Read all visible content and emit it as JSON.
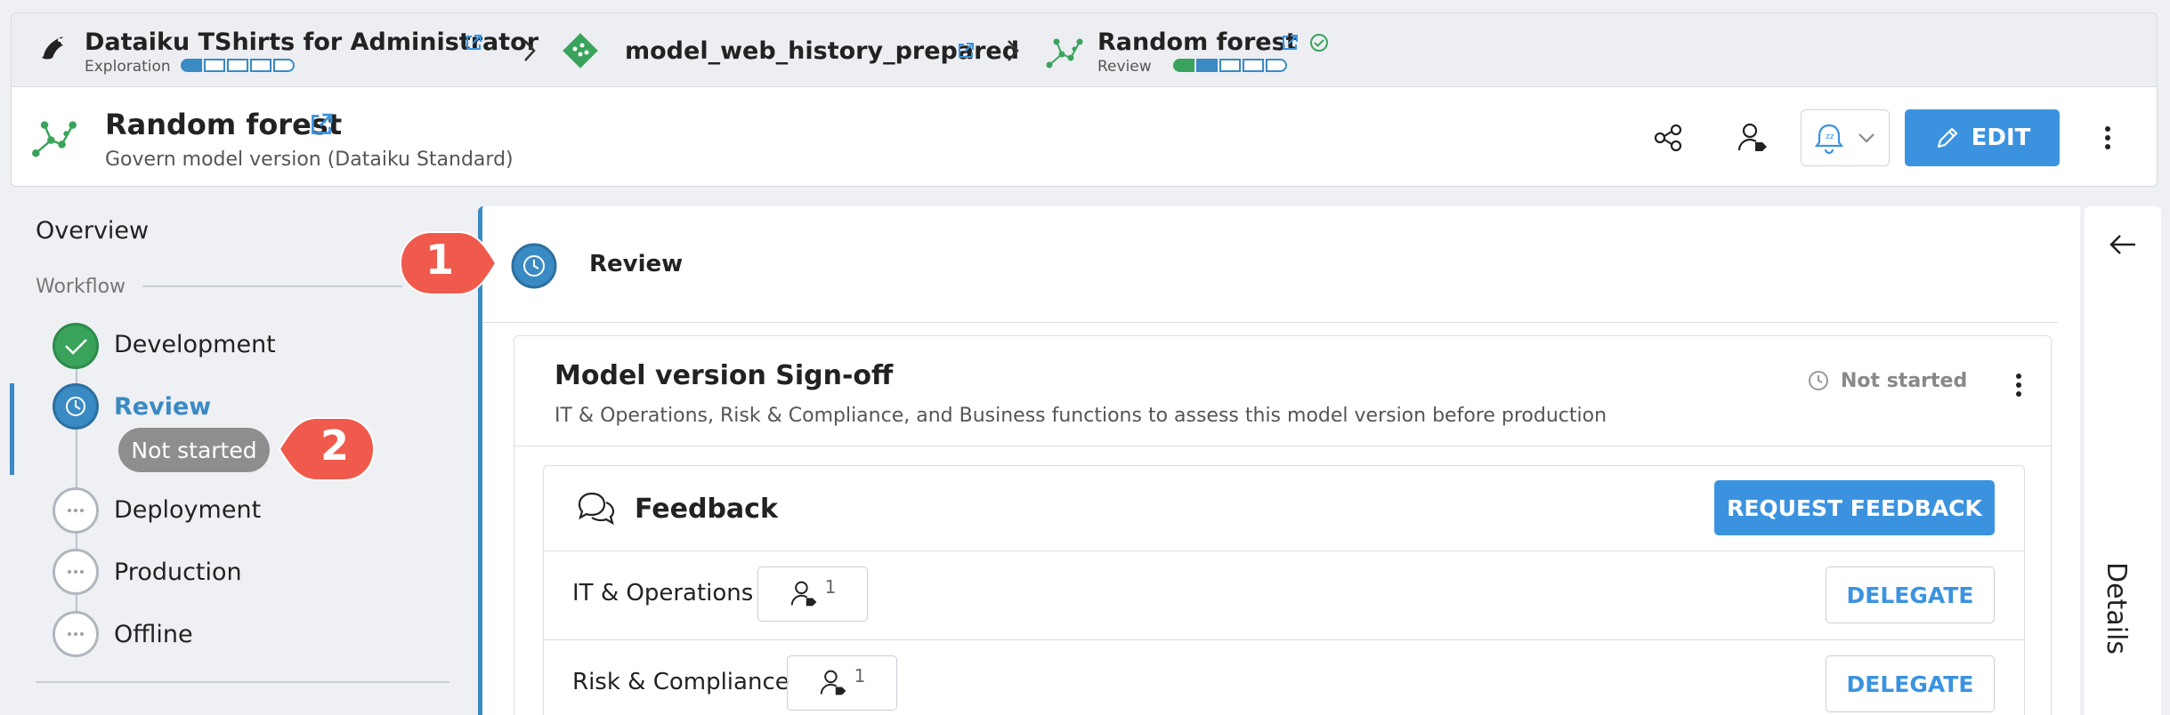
{
  "breadcrumb": {
    "project": {
      "title": "Dataiku TShirts for Administrator",
      "subtitle": "Exploration"
    },
    "model": {
      "title": "model_web_history_prepared"
    },
    "version": {
      "title": "Random forest",
      "subtitle": "Review"
    }
  },
  "header": {
    "title": "Random forest",
    "subtitle": "Govern model version (Dataiku Standard)",
    "edit_label": "EDIT"
  },
  "nav": {
    "overview": "Overview",
    "workflow_label": "Workflow",
    "stages": [
      {
        "label": "Development",
        "state": "done"
      },
      {
        "label": "Review",
        "state": "active"
      },
      {
        "label": "Deployment",
        "state": "pending"
      },
      {
        "label": "Production",
        "state": "pending"
      },
      {
        "label": "Offline",
        "state": "pending"
      }
    ],
    "review_status": "Not started"
  },
  "main": {
    "step_title": "Review",
    "card": {
      "title": "Model version Sign-off",
      "description": "IT & Operations, Risk & Compliance, and Business functions to assess this model version before production",
      "status": "Not started"
    },
    "feedback": {
      "title": "Feedback",
      "request_label": "REQUEST FEEDBACK",
      "rows": [
        {
          "label": "IT & Operations",
          "count": "1",
          "action": "DELEGATE"
        },
        {
          "label": "Risk & Compliance",
          "count": "1",
          "action": "DELEGATE"
        }
      ]
    }
  },
  "details": {
    "label": "Details"
  },
  "callouts": {
    "one": "1",
    "two": "2"
  },
  "colors": {
    "accent": "#3b93e0",
    "active_stage": "#3a8ac4",
    "done_stage": "#3aa35b",
    "callout": "#ef5a4c"
  },
  "icons": [
    "bird-logo-icon",
    "dataset-icon",
    "model-icon",
    "external-link-icon",
    "chevron-right-icon",
    "check-circle-icon",
    "share-graph-icon",
    "user-tag-icon",
    "bell-snooze-icon",
    "chevron-down-icon",
    "pencil-icon",
    "kebab-menu-icon",
    "clock-icon",
    "chat-bubbles-icon",
    "arrow-left-icon"
  ]
}
